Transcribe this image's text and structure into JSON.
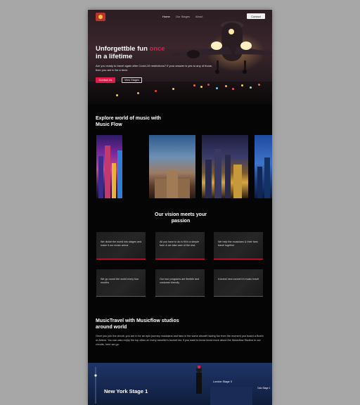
{
  "header": {
    "nav": [
      "Home",
      "Our Stages",
      "About"
    ],
    "contact_button": "Contact"
  },
  "hero": {
    "title_part1": "Unforgettble fun ",
    "title_accent": "once",
    "title_part2": "in a lifetime",
    "text": "Are you ready to travel again after Covid-19 restrictions? If your answer is yes to any of those, then you are in for a treat.",
    "primary_button": "Contact Us",
    "secondary_button": "View Stages"
  },
  "explore": {
    "title": "Explore world of music with Music Flow"
  },
  "vision": {
    "title": "Our vision meets your passion",
    "cards": [
      "We divide the world into stages and make it our music arena",
      "All you have to do is fill in a simple form & we take care of the rest.",
      "We help the musicians & their fans travel together",
      "We go round the world every four months",
      "Our tour programs are flexible and customer friendly",
      "A brand new concert in music travel"
    ]
  },
  "studios": {
    "title": "MusicTravel with Musicflow studios around world",
    "text": "Once you join the circuit, you are in for an epic journey musicians and fans in the same aircraft having fun from the moment you board a Boein or Airbus. You can also enjoy the top cities on every traveller's bucket list, if you want to know know more about the Musicflow Studios in our circuits, here we go."
  },
  "stages": {
    "main": "New York Stage 1",
    "card": "London Stage 3",
    "side": "Oslo Stage 1"
  },
  "colors": {
    "accent": "#e21c4a",
    "page_bg": "#050505",
    "outer_bg": "#a7a7a7",
    "stages_bg": "#1f3566"
  }
}
